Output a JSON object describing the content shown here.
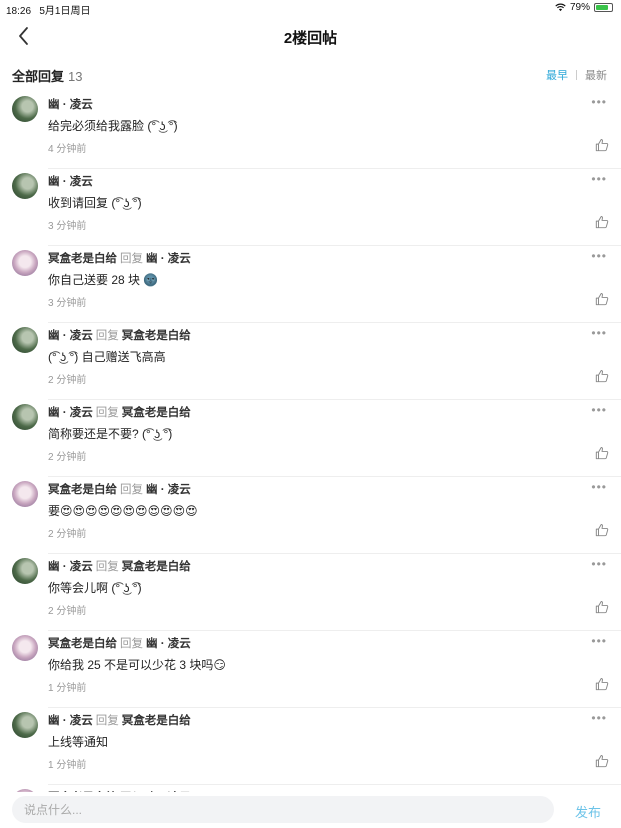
{
  "status_bar": {
    "time": "18:26",
    "date": "5月1日周日",
    "battery": "79%",
    "battery_level": 0.79
  },
  "nav": {
    "title": "2楼回帖"
  },
  "reply_header": {
    "label": "全部回复",
    "count": "13",
    "sort_earliest": "最早",
    "sort_latest": "最新"
  },
  "reply_word": "回复",
  "comments": [
    {
      "name": "幽 · 凌云",
      "avatar": "a1",
      "reply_to": "",
      "content": "给完必须给我露脸 (͡° ͜ʖ ͡°)",
      "time": "4 分钟前"
    },
    {
      "name": "幽 · 凌云",
      "avatar": "a1",
      "reply_to": "",
      "content": "收到请回复 (͡° ͜ʖ ͡°)",
      "time": "3 分钟前"
    },
    {
      "name": "冥盒老是白给",
      "avatar": "a2",
      "reply_to": "幽 · 凌云",
      "content": "你自己送要 28 块 🌚",
      "time": "3 分钟前"
    },
    {
      "name": "幽 · 凌云",
      "avatar": "a1",
      "reply_to": "冥盒老是白给",
      "content": "(͡° ͜ʖ ͡°) 自己赠送飞高高",
      "time": "2 分钟前"
    },
    {
      "name": "幽 · 凌云",
      "avatar": "a1",
      "reply_to": "冥盒老是白给",
      "content": "简称要还是不要? (͡° ͜ʖ ͡°)",
      "time": "2 分钟前"
    },
    {
      "name": "冥盒老是白给",
      "avatar": "a2",
      "reply_to": "幽 · 凌云",
      "content": "要😍😍😍😍😍😍😍😍😍😍😍",
      "time": "2 分钟前"
    },
    {
      "name": "幽 · 凌云",
      "avatar": "a1",
      "reply_to": "冥盒老是白给",
      "content": "你等会儿啊 (͡° ͜ʖ ͡°)",
      "time": "2 分钟前"
    },
    {
      "name": "冥盒老是白给",
      "avatar": "a2",
      "reply_to": "幽 · 凌云",
      "content": "你给我 25 不是可以少花 3 块吗😏",
      "time": "1 分钟前"
    },
    {
      "name": "幽 · 凌云",
      "avatar": "a1",
      "reply_to": "冥盒老是白给",
      "content": "上线等通知",
      "time": "1 分钟前"
    },
    {
      "name": "冥盒老是白给",
      "avatar": "a2",
      "reply_to": "幽 · 凌云",
      "content": "",
      "time": ""
    }
  ],
  "input_bar": {
    "placeholder": "说点什么...",
    "send_label": "发布"
  },
  "colors": {
    "accent": "#2ba7d8",
    "send": "#6cc3e8",
    "battery": "#3ac34a"
  }
}
